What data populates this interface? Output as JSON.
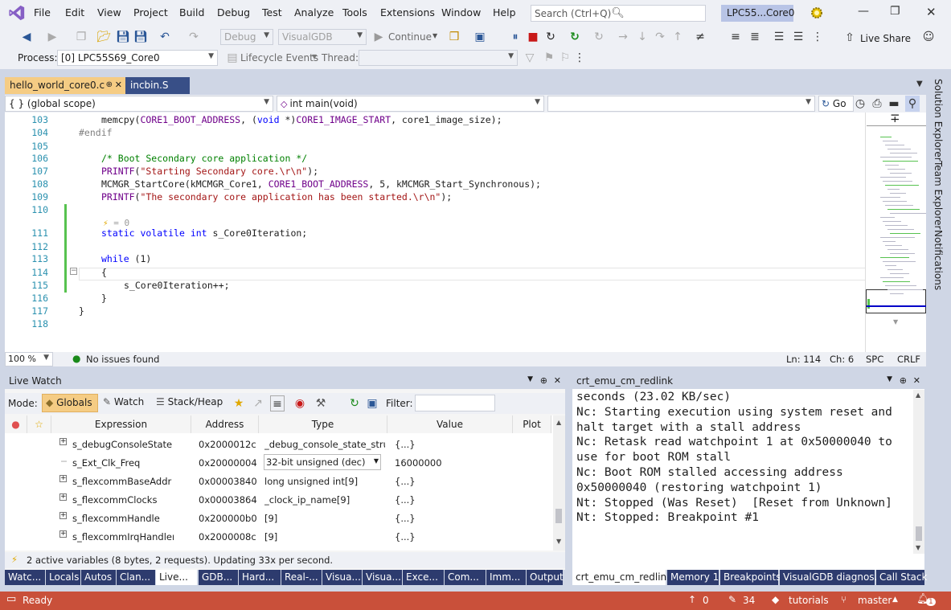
{
  "menu": [
    "File",
    "Edit",
    "View",
    "Project",
    "Build",
    "Debug",
    "Test",
    "Analyze",
    "Tools",
    "Extensions",
    "Window",
    "Help"
  ],
  "search": {
    "placeholder": "Search (Ctrl+Q)"
  },
  "project_name": "LPC55...Core0",
  "toolbar": {
    "config": "Debug",
    "platform": "VisualGDB",
    "continue": "Continue",
    "live_share": "Live Share"
  },
  "toolbar2": {
    "process_label": "Process:",
    "process_value": "[0] LPC55S69_Core0",
    "lifecycle": "Lifecycle Events",
    "thread_label": "Thread:"
  },
  "editor_tabs": [
    {
      "label": "hello_world_core0.c",
      "active": true
    },
    {
      "label": "incbin.S",
      "active": false
    }
  ],
  "nav": {
    "scope": "{ } (global scope)",
    "function": "int main(void)",
    "go": "Go"
  },
  "code": [
    {
      "n": "103",
      "html": "memcpy(CORE1_BOOT_ADDRESS, (void *)CORE1_IMAGE_START, core1_image_size);",
      "indent": 4
    },
    {
      "n": "104",
      "html": "#endif",
      "indent": 0
    },
    {
      "n": "105",
      "html": "",
      "indent": 0
    },
    {
      "n": "106",
      "html": "/* Boot Secondary core application */",
      "indent": 4
    },
    {
      "n": "107",
      "html": "PRINTF(\"Starting Secondary core.\\r\\n\");",
      "indent": 4
    },
    {
      "n": "108",
      "html": "MCMGR_StartCore(kMCMGR_Core1, CORE1_BOOT_ADDRESS, 5, kMCMGR_Start_Synchronous);",
      "indent": 4
    },
    {
      "n": "109",
      "html": "PRINTF(\"The secondary core application has been started.\\r\\n\");",
      "indent": 4
    },
    {
      "n": "110",
      "html": "",
      "indent": 0
    },
    {
      "n": "111",
      "html": "static volatile int s_Core0Iteration;",
      "indent": 4
    },
    {
      "n": "112",
      "html": "",
      "indent": 0
    },
    {
      "n": "113",
      "html": "while (1)",
      "indent": 4
    },
    {
      "n": "114",
      "html": "{",
      "indent": 4
    },
    {
      "n": "115",
      "html": "s_Core0Iteration++;",
      "indent": 8
    },
    {
      "n": "116",
      "html": "}",
      "indent": 4
    },
    {
      "n": "117",
      "html": "}",
      "indent": 0
    },
    {
      "n": "118",
      "html": "",
      "indent": 0
    }
  ],
  "inline_hint": "= 0",
  "editor_status": {
    "zoom": "100 %",
    "issues": "No issues found",
    "ln": "Ln: 114",
    "ch": "Ch: 6",
    "spc": "SPC",
    "crlf": "CRLF"
  },
  "side_tabs": [
    "Solution Explorer",
    "Team Explorer",
    "Notifications"
  ],
  "live_watch": {
    "title": "Live Watch",
    "mode_label": "Mode:",
    "modes": [
      "Globals",
      "Watch",
      "Stack/Heap"
    ],
    "filter_label": "Filter:",
    "columns": [
      "Expression",
      "Address",
      "Type",
      "Value",
      "Plot"
    ],
    "rows": [
      {
        "expr": "s_debugConsoleState",
        "addr": "0x2000012c",
        "type": "_debug_console_state_struct",
        "value": "{...}",
        "expand": true
      },
      {
        "expr": "s_Ext_Clk_Freq",
        "addr": "0x20000004",
        "type": "32-bit unsigned (dec)",
        "value": "16000000",
        "expand": false
      },
      {
        "expr": "s_flexcommBaseAddr",
        "addr": "0x00003840",
        "type": "long unsigned int[9]",
        "value": "{...}",
        "expand": true
      },
      {
        "expr": "s_flexcommClocks",
        "addr": "0x00003864",
        "type": "_clock_ip_name[9]",
        "value": "{...}",
        "expand": true
      },
      {
        "expr": "s_flexcommHandle",
        "addr": "0x200000b0",
        "type": "[9]",
        "value": "{...}",
        "expand": true
      },
      {
        "expr": "s_flexcommIrqHandler",
        "addr": "0x2000008c",
        "type": "[9]",
        "value": "{...}",
        "expand": true
      }
    ],
    "status": "2 active variables (8 bytes, 2 requests). Updating 33x per second."
  },
  "output": {
    "title": "crt_emu_cm_redlink",
    "text": "seconds (23.02 KB/sec)\nNc: Starting execution using system reset and halt target with a stall address\nNc: Retask read watchpoint 1 at 0x50000040 to use for boot ROM stall\nNc: Boot ROM stalled accessing address 0x50000040 (restoring watchpoint 1)\nNt: Stopped (Was Reset)  [Reset from Unknown]\nNt: Stopped: Breakpoint #1"
  },
  "bottom_tabs_left": [
    "Watc...",
    "Locals",
    "Autos",
    "Clan...",
    "Live...",
    "GDB...",
    "Hard...",
    "Real-...",
    "Visua...",
    "Visua...",
    "Exce...",
    "Com...",
    "Imm...",
    "Output"
  ],
  "bottom_tabs_right": [
    "crt_emu_cm_redlink",
    "Memory 1",
    "Breakpoints",
    "VisualGDB diagnos...",
    "Call Stack"
  ],
  "statusbar": {
    "ready": "Ready",
    "up": "0",
    "edits": "34",
    "repo": "tutorials",
    "branch": "master",
    "bell": "1"
  },
  "colors": {
    "accent": "#c9503a",
    "tab_active": "#f5cc84",
    "bottom_tab": "#2d3b6e"
  }
}
